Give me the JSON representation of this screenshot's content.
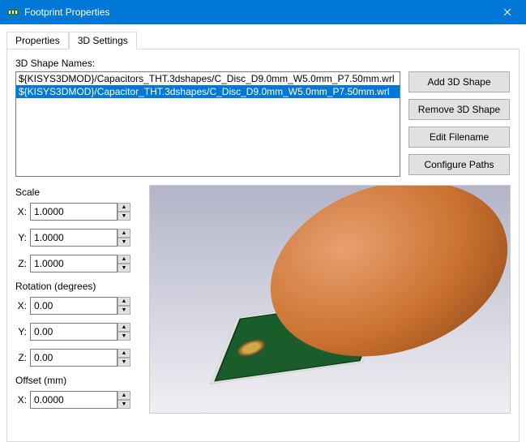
{
  "window": {
    "title": "Footprint Properties"
  },
  "tabs": {
    "properties": "Properties",
    "settings3d": "3D Settings"
  },
  "shapes": {
    "label": "3D Shape Names:",
    "items": [
      "${KISYS3DMOD}/Capacitors_THT.3dshapes/C_Disc_D9.0mm_W5.0mm_P7.50mm.wrl",
      "${KISYS3DMOD}/Capacitor_THT.3dshapes/C_Disc_D9.0mm_W5.0mm_P7.50mm.wrl"
    ]
  },
  "buttons": {
    "add": "Add 3D Shape",
    "remove": "Remove 3D Shape",
    "edit": "Edit Filename",
    "config": "Configure Paths"
  },
  "scale": {
    "title": "Scale",
    "x_label": "X:",
    "x": "1.0000",
    "y_label": "Y:",
    "y": "1.0000",
    "z_label": "Z:",
    "z": "1.0000"
  },
  "rotation": {
    "title": "Rotation (degrees)",
    "x_label": "X:",
    "x": "0.00",
    "y_label": "Y:",
    "y": "0.00",
    "z_label": "Z:",
    "z": "0.00"
  },
  "offset": {
    "title": "Offset (mm)",
    "x_label": "X:",
    "x": "0.0000"
  }
}
